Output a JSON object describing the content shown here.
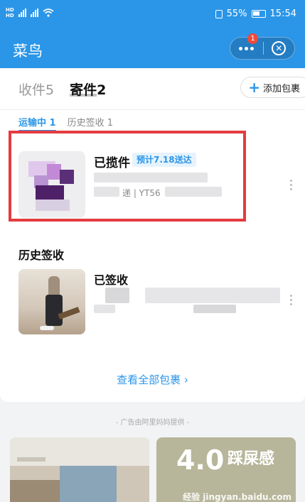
{
  "status_bar": {
    "sim1": "HD",
    "sim2": "HD",
    "battery": "55%",
    "time": "15:54"
  },
  "header": {
    "title": "菜鸟",
    "notification_count": "1",
    "more_icon": "more-dots-icon",
    "close_icon": "close-circle-icon"
  },
  "tabs": [
    {
      "label": "收件",
      "count": "5"
    },
    {
      "label": "寄件",
      "count": "2"
    }
  ],
  "add_button": {
    "label": "添加包裹"
  },
  "subtabs": [
    {
      "label": "运输中 1"
    },
    {
      "label": "历史签收 1"
    }
  ],
  "in_transit_package": {
    "status": "已揽件",
    "eta": "预计7.18送达",
    "tracking": "递 | YT56"
  },
  "history_section": {
    "title": "历史签收",
    "package_status": "已签收"
  },
  "view_all": "查看全部包裹 ›",
  "ad_note": "- 广告由阿里妈妈提供 -",
  "ads": [
    {
      "big_text": "4.0",
      "text": "踩屎感"
    }
  ],
  "watermark": "经验 jingyan.baidu.com",
  "colors": {
    "primary": "#2b96e8",
    "highlight_box": "#e43b40",
    "badge": "#f04a3a"
  }
}
